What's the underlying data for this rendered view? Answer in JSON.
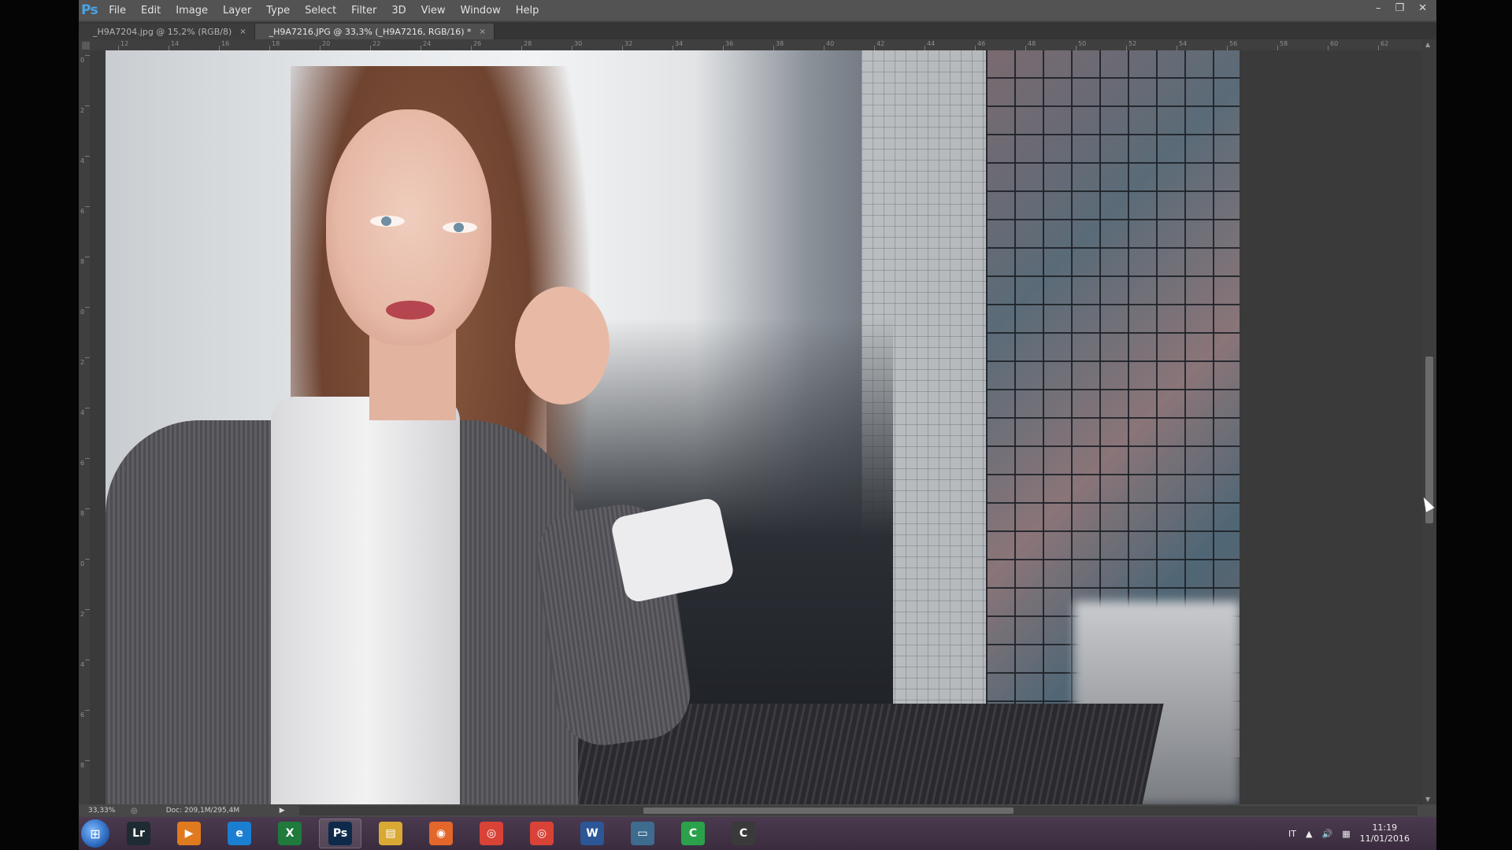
{
  "app": {
    "logo": "Ps",
    "menu": [
      "File",
      "Edit",
      "Image",
      "Layer",
      "Type",
      "Select",
      "Filter",
      "3D",
      "View",
      "Window",
      "Help"
    ],
    "window_controls": {
      "minimize": "–",
      "restore": "❐",
      "close": "✕"
    }
  },
  "tabs": [
    {
      "label": "_H9A7204.jpg @ 15,2% (RGB/8)",
      "close": "×"
    },
    {
      "label": "_H9A7216.JPG @ 33,3% (_H9A7216, RGB/16) *",
      "close": "×"
    }
  ],
  "ruler": {
    "top_labels": [
      "12",
      "14",
      "16",
      "18",
      "20",
      "22",
      "24",
      "26",
      "28",
      "30",
      "32",
      "34",
      "36",
      "38",
      "40",
      "42",
      "44",
      "46",
      "48",
      "50",
      "52",
      "54",
      "56",
      "58",
      "60",
      "62"
    ],
    "left_labels": [
      "0",
      "2",
      "4",
      "6",
      "8",
      "0",
      "2",
      "4",
      "6",
      "8",
      "0",
      "2",
      "4",
      "6",
      "8",
      "6"
    ]
  },
  "status": {
    "zoom": "33,33%",
    "doc_info": "Doc: 209,1M/295,4M",
    "arrow": "▶"
  },
  "scroll": {
    "vertical_position": 0.53,
    "horizontal_position": 0.46
  },
  "taskbar": {
    "start_symbol": "⊞",
    "icons": [
      {
        "name": "lightroom",
        "glyph": "Lr",
        "color": "#1f2b33"
      },
      {
        "name": "media-player",
        "glyph": "▶",
        "color": "#e07a1f"
      },
      {
        "name": "internet-explorer",
        "glyph": "e",
        "color": "#1b7fd1"
      },
      {
        "name": "excel-app",
        "glyph": "X",
        "color": "#1f7a3b"
      },
      {
        "name": "photoshop",
        "glyph": "Ps",
        "color": "#0e2a4a"
      },
      {
        "name": "file-explorer",
        "glyph": "▤",
        "color": "#d9a934"
      },
      {
        "name": "firefox",
        "glyph": "◉",
        "color": "#e3662a"
      },
      {
        "name": "chrome",
        "glyph": "◎",
        "color": "#d94236"
      },
      {
        "name": "chrome",
        "glyph": "◎",
        "color": "#d94236"
      },
      {
        "name": "word",
        "glyph": "W",
        "color": "#2b5797"
      },
      {
        "name": "window-app",
        "glyph": "▭",
        "color": "#3d6c8f"
      },
      {
        "name": "camtasia",
        "glyph": "C",
        "color": "#2aa14a"
      },
      {
        "name": "camtasia-recorder",
        "glyph": "C",
        "color": "#3a3a3a"
      }
    ],
    "tray": {
      "language": "IT",
      "time": "11:19",
      "date": "11/01/2016"
    }
  }
}
